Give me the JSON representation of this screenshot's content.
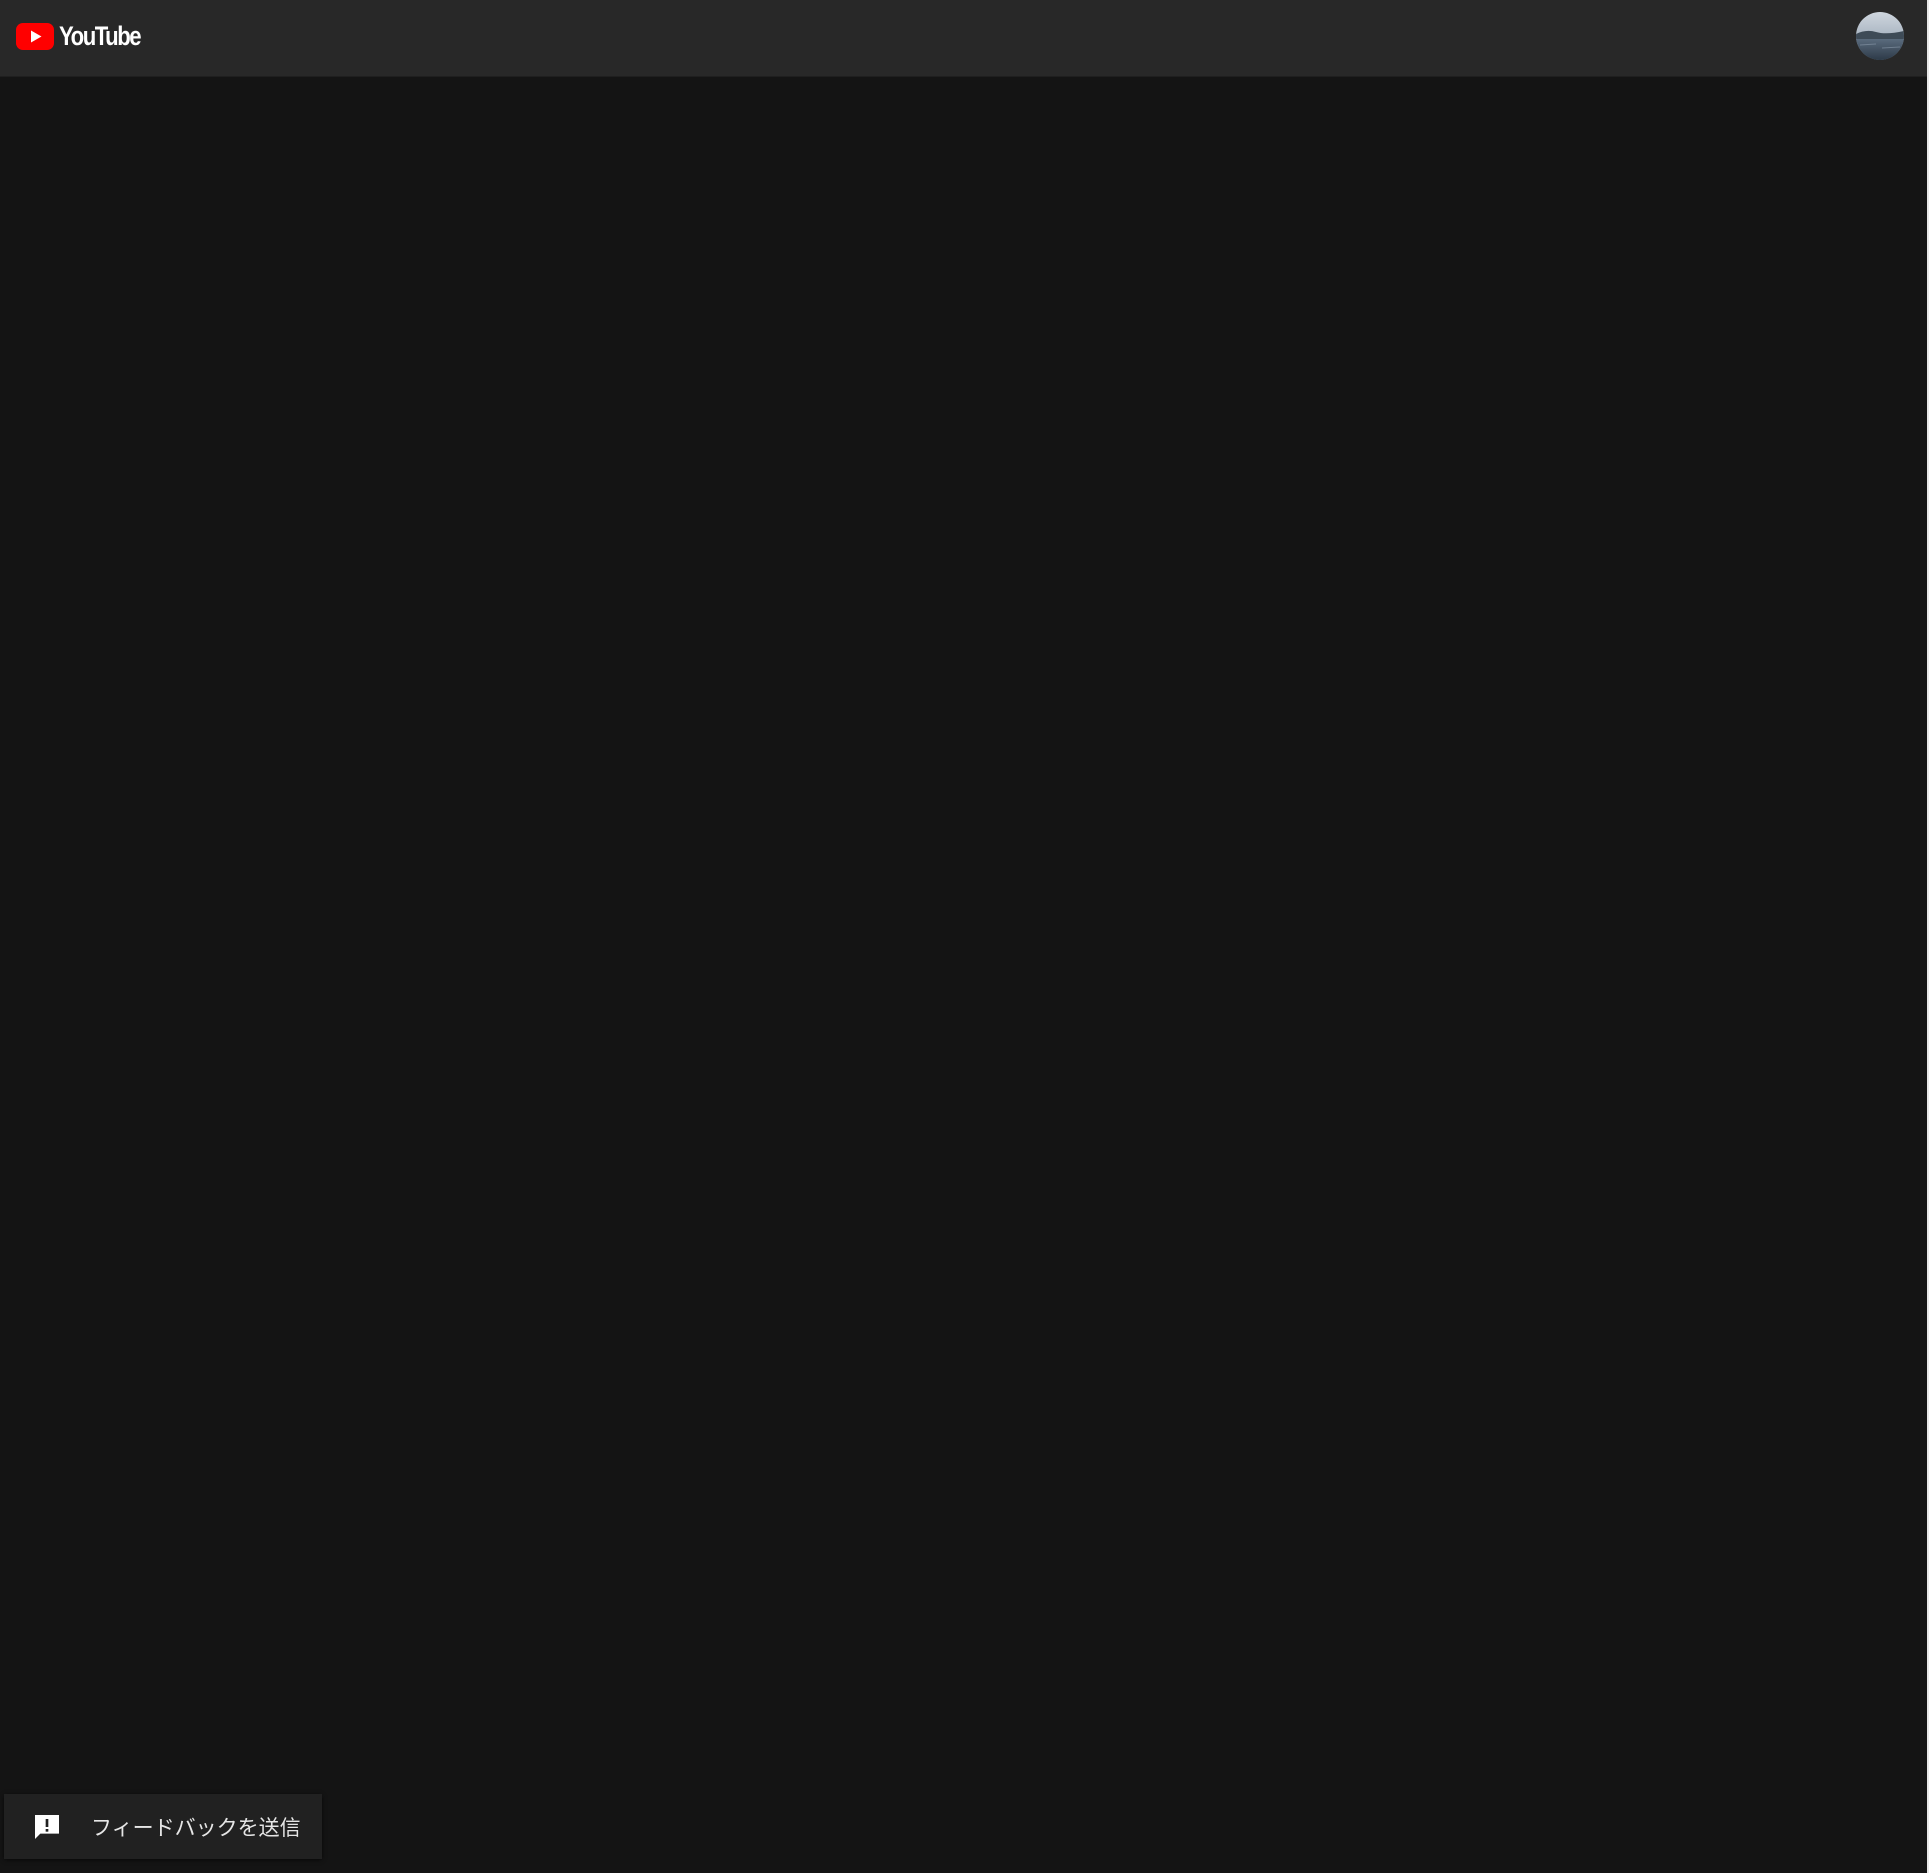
{
  "header": {
    "logo_text": "YouTube",
    "logo_icon": "youtube-play-icon",
    "avatar_icon": "account-avatar"
  },
  "feedback": {
    "label": "フィードバックを送信",
    "icon": "feedback-icon"
  },
  "colors": {
    "background": "#141414",
    "header": "#282828",
    "brand_red": "#ff0000",
    "feedback_bg": "#212121"
  }
}
